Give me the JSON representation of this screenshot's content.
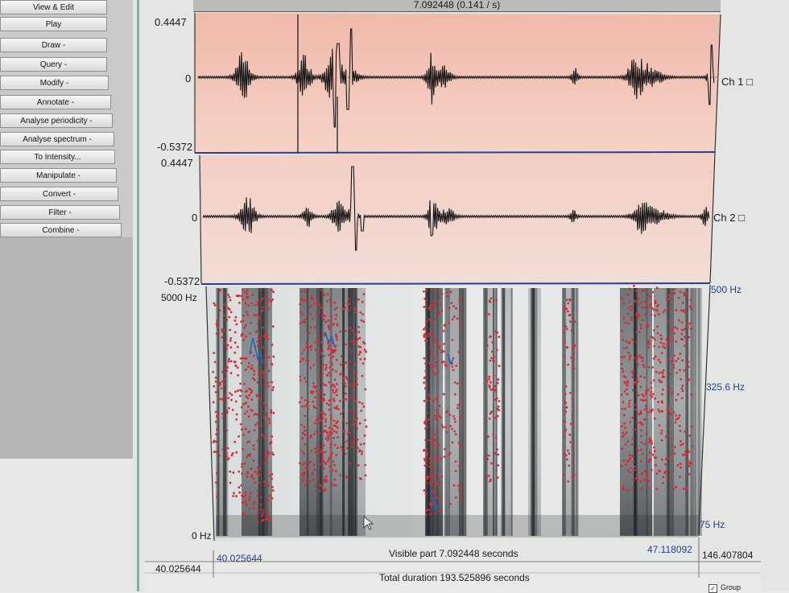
{
  "sidebar": {
    "buttons": [
      "View & Edit",
      "Play",
      "Draw -",
      "Query -",
      "Modify -",
      "Annotate -",
      "Analyse periodicity -",
      "Analyse spectrum -",
      "To Intensity...",
      "Manipulate -",
      "Convert -",
      "Filter -",
      "Combine -"
    ]
  },
  "editor": {
    "title": "7.092448 (0.141 / s)",
    "ch1": {
      "label": "Ch 1 □",
      "ymax": "0.4447",
      "zero": "0",
      "ymin": "-0.5372"
    },
    "ch2": {
      "label": "Ch 2 □",
      "ymax": "0.4447",
      "zero": "0",
      "ymin": "-0.5372"
    },
    "spectrogram": {
      "freq_top": "5000 Hz",
      "freq_bottom": "0 Hz",
      "pitch_top": "500 Hz",
      "pitch_mid": "325.6 Hz",
      "pitch_bottom": "75 Hz"
    },
    "time": {
      "window_start": "40.025644",
      "window_end": "47.118092",
      "visible_label": "Visible part 7.092448 seconds",
      "total_start": "40.025644",
      "total_end": "146.407804",
      "total_label": "Total duration 193.525896 seconds"
    },
    "group": {
      "label": "Group",
      "checked": true
    }
  },
  "colors": {
    "waveform_bg": "#f3c9bb",
    "spectrogram_bg": "#dfe2e1",
    "formant_dots": "#d72a36",
    "pitch_line": "#1e64c8",
    "axis_blue": "#2a3c97"
  }
}
